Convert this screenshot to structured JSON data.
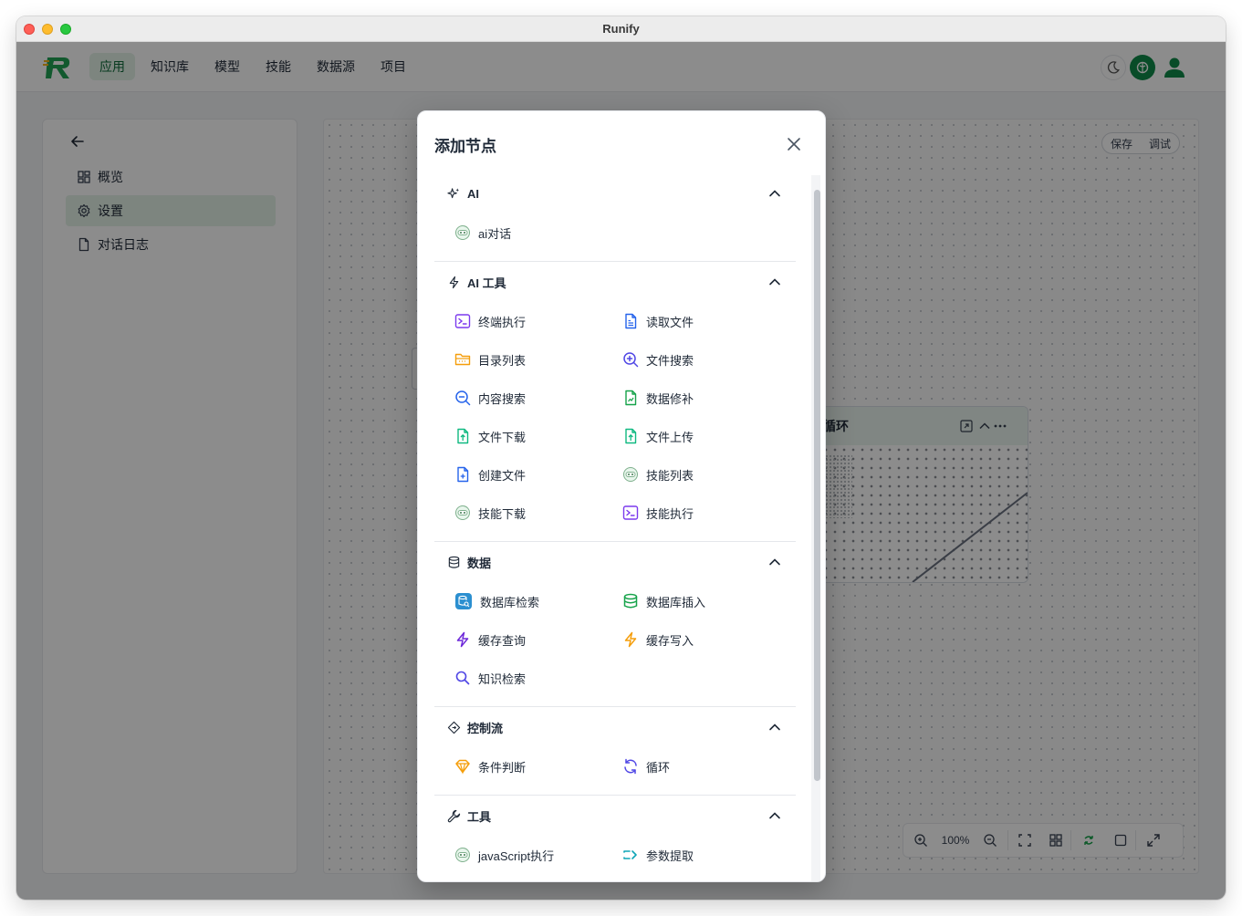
{
  "window": {
    "title": "Runify"
  },
  "topnav": {
    "items": [
      "应用",
      "知识库",
      "模型",
      "技能",
      "数据源",
      "项目"
    ],
    "active": "应用"
  },
  "sidebar": {
    "items": [
      {
        "label": "概览",
        "icon": "dashboard-icon"
      },
      {
        "label": "设置",
        "icon": "gear-icon"
      },
      {
        "label": "对话日志",
        "icon": "file-icon"
      }
    ],
    "active": "设置"
  },
  "canvas": {
    "save_label": "保存",
    "debug_label": "调试",
    "loop_node_title": "循环",
    "zoom_level": "100%"
  },
  "modal": {
    "title": "添加节点",
    "sections": [
      {
        "title": "AI",
        "icon": "sparkles-icon",
        "items": [
          {
            "label": "ai对话",
            "icon": "robot-icon"
          }
        ]
      },
      {
        "title": "AI 工具",
        "icon": "bolt-icon",
        "items": [
          {
            "label": "终端执行",
            "icon": "terminal-icon"
          },
          {
            "label": "读取文件",
            "icon": "file-text-icon"
          },
          {
            "label": "目录列表",
            "icon": "folder-icon"
          },
          {
            "label": "文件搜索",
            "icon": "zoom-in-icon"
          },
          {
            "label": "内容搜索",
            "icon": "zoom-out-icon"
          },
          {
            "label": "数据修补",
            "icon": "file-chart-icon"
          },
          {
            "label": "文件下载",
            "icon": "file-arrow-icon"
          },
          {
            "label": "文件上传",
            "icon": "file-arrow-icon"
          },
          {
            "label": "创建文件",
            "icon": "file-plus-icon"
          },
          {
            "label": "技能列表",
            "icon": "robot-icon"
          },
          {
            "label": "技能下载",
            "icon": "robot-icon"
          },
          {
            "label": "技能执行",
            "icon": "terminal-icon"
          }
        ]
      },
      {
        "title": "数据",
        "icon": "database-icon",
        "items": [
          {
            "label": "数据库检索",
            "icon": "db-search-icon"
          },
          {
            "label": "数据库插入",
            "icon": "database-icon"
          },
          {
            "label": "缓存查询",
            "icon": "bolt-icon"
          },
          {
            "label": "缓存写入",
            "icon": "bolt-icon"
          },
          {
            "label": "知识检索",
            "icon": "search-icon"
          }
        ]
      },
      {
        "title": "控制流",
        "icon": "diamond-icon",
        "items": [
          {
            "label": "条件判断",
            "icon": "diamond-icon"
          },
          {
            "label": "循环",
            "icon": "refresh-icon"
          }
        ]
      },
      {
        "title": "工具",
        "icon": "wrench-icon",
        "items": [
          {
            "label": "javaScript执行",
            "icon": "robot-icon"
          },
          {
            "label": "参数提取",
            "icon": "extract-icon"
          }
        ]
      }
    ]
  },
  "colors": {
    "brand_green": "#16a34a",
    "purple": "#7c3aed",
    "blue": "#2563eb",
    "orange": "#f59e0b",
    "teal": "#10b981"
  }
}
